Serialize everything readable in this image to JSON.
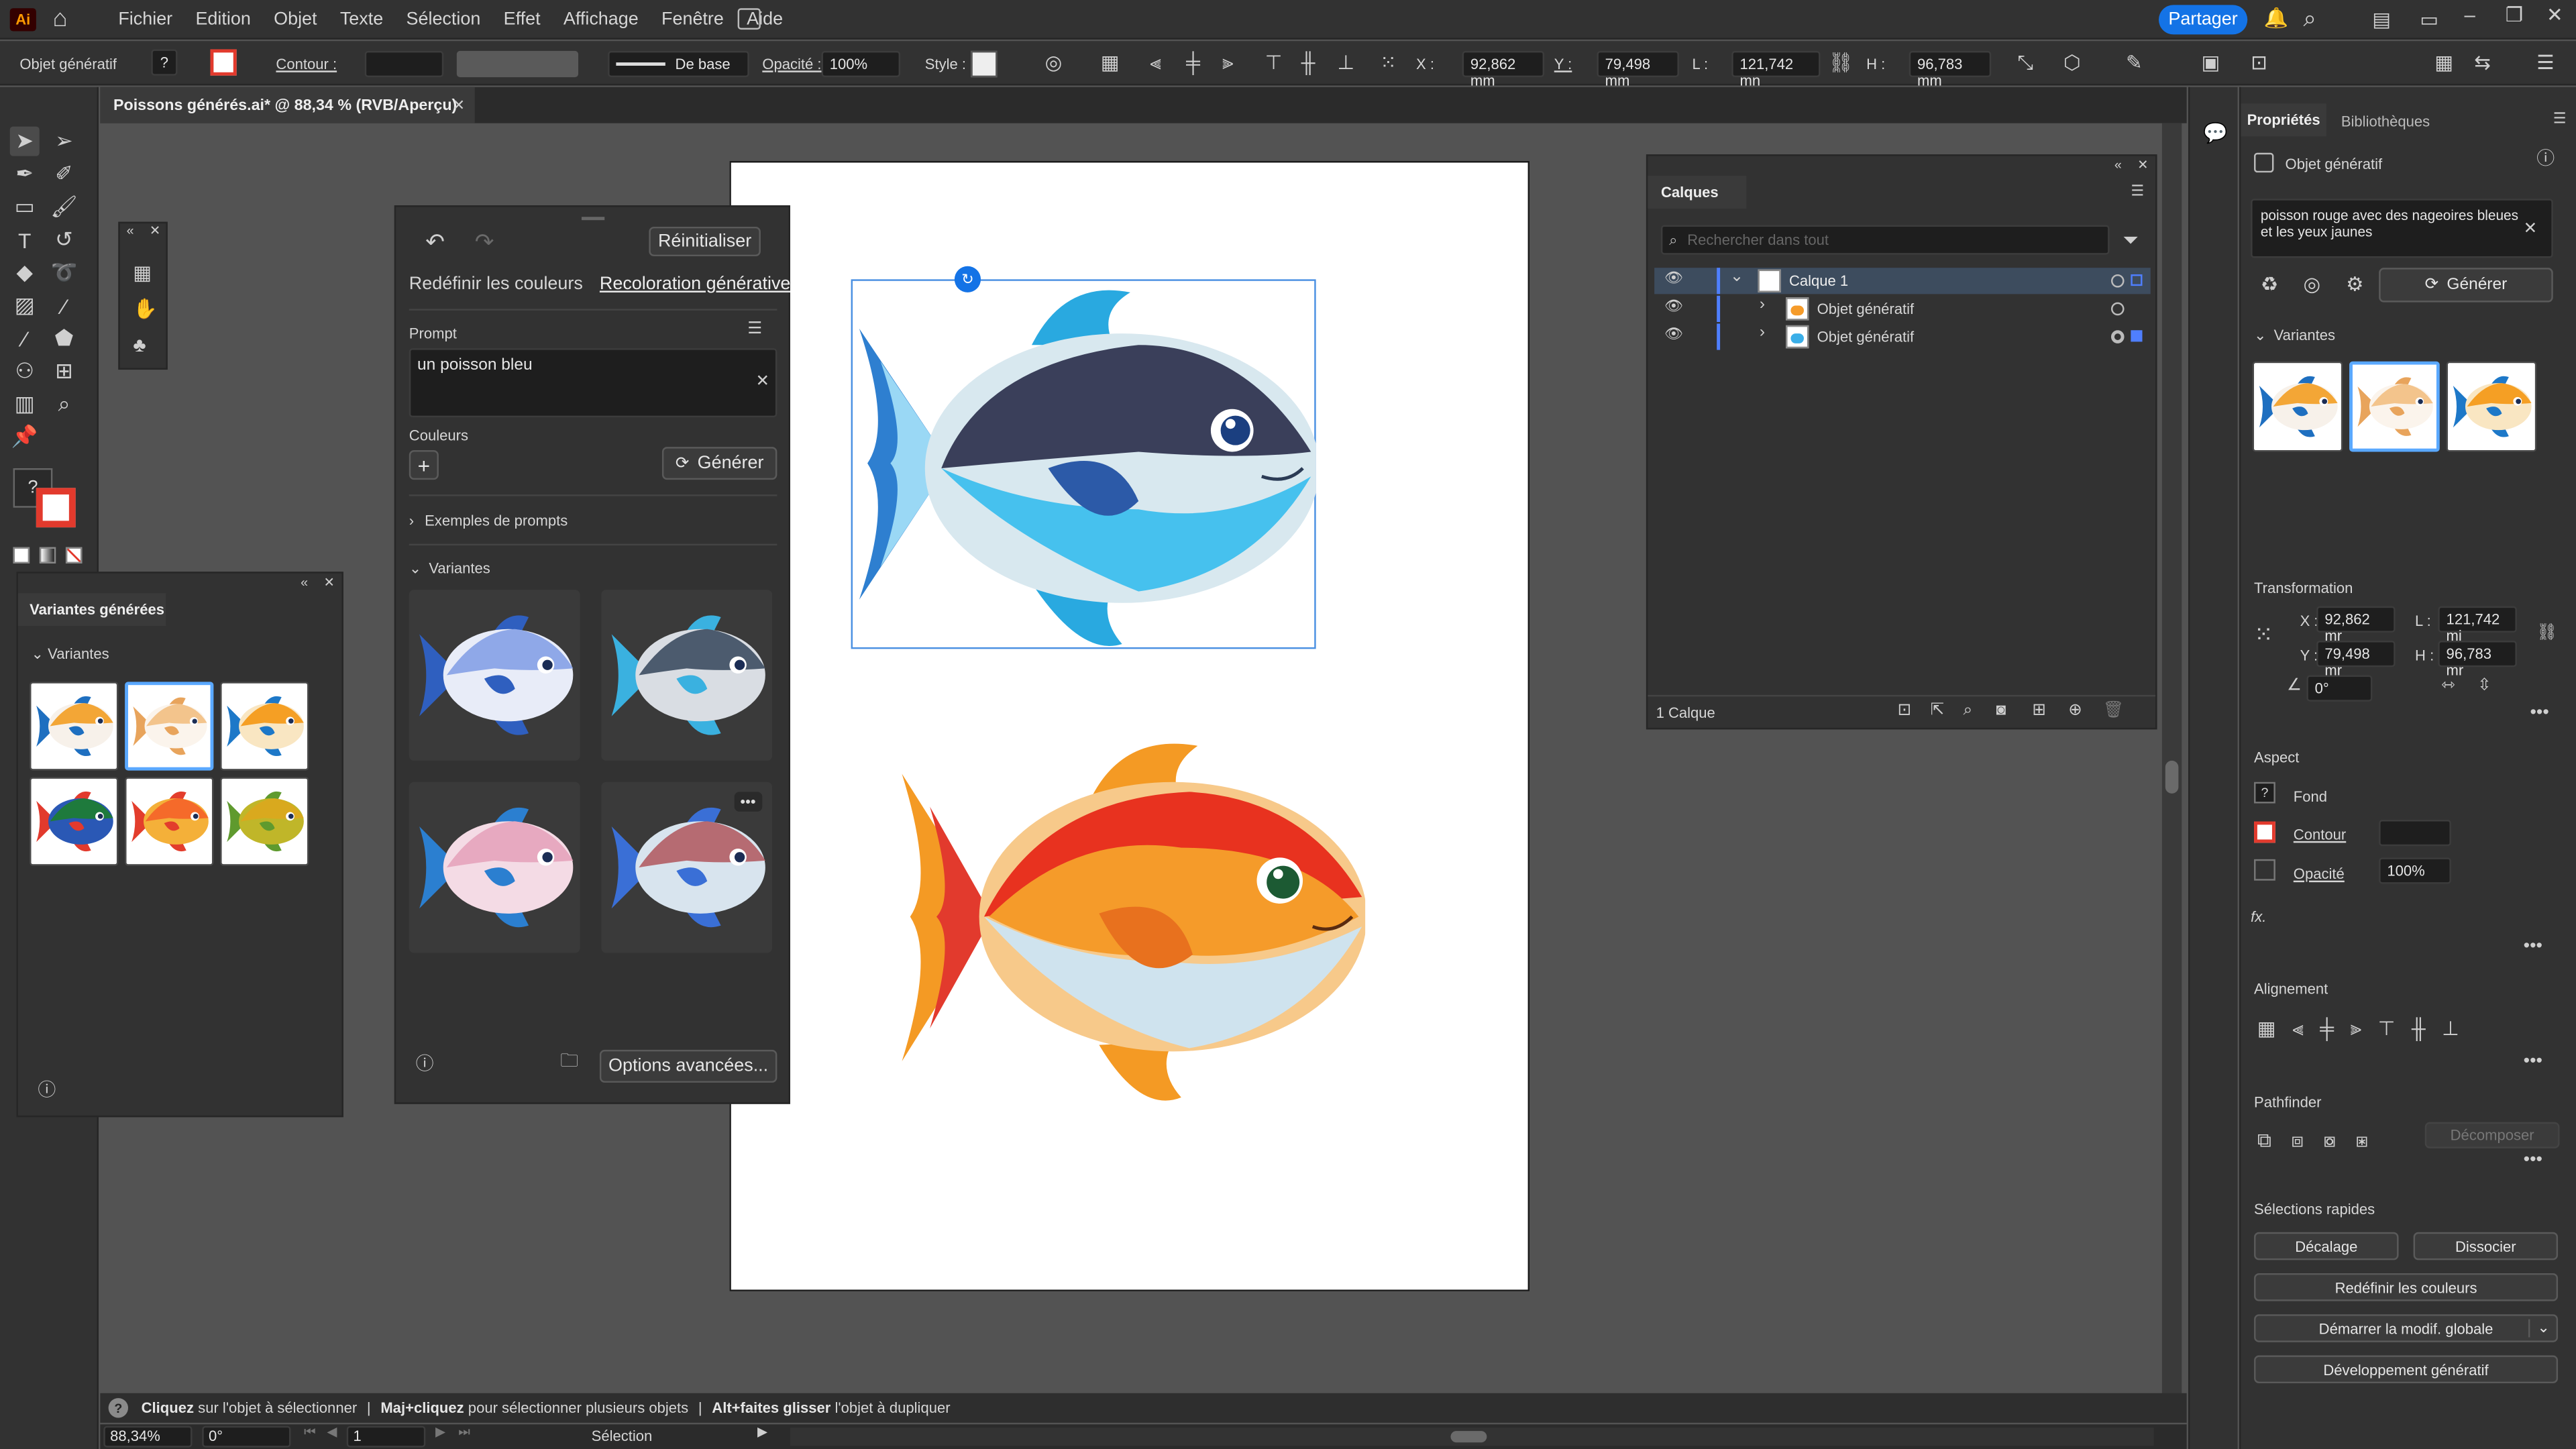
{
  "menubar": {
    "app_logo": "Ai",
    "items": [
      "Fichier",
      "Edition",
      "Objet",
      "Texte",
      "Sélection",
      "Effet",
      "Affichage",
      "Fenêtre",
      "Aide"
    ],
    "share_label": "Partager"
  },
  "controlbar": {
    "object_label": "Objet génératif",
    "contour_label": "Contour :",
    "stroke_style": "De base",
    "opacity_label": "Opacité :",
    "opacity_value": "100%",
    "style_label": "Style :",
    "x_label": "X :",
    "x_value": "92,862 mm",
    "y_label": "Y :",
    "y_value": "79,498 mm",
    "w_label": "L :",
    "w_value": "121,742 mn",
    "h_label": "H :",
    "h_value": "96,783 mm"
  },
  "document_tab": {
    "title": "Poissons générés.ai* @ 88,34 % (RVB/Aperçu)"
  },
  "toolbar_fill_stroke": {
    "question_mark": "?"
  },
  "variants_panel": {
    "title": "Variantes générées",
    "section": "Variantes",
    "colors": [
      [
        "#f3a636",
        "#f7f1ea",
        "#1e6fc0"
      ],
      [
        "#f3c48c",
        "#fbf4ec",
        "#e8a45c"
      ],
      [
        "#f59f24",
        "#f9e6c2",
        "#1d78c8"
      ],
      [
        "#1e7a3c",
        "#2a58b5",
        "#e23a2d"
      ],
      [
        "#f56a2a",
        "#f4b039",
        "#e33d2c"
      ],
      [
        "#d9a91e",
        "#c0b629",
        "#5f9a2e"
      ]
    ]
  },
  "recolor_panel": {
    "tabs": [
      "Redéfinir les couleurs",
      "Recoloration générative"
    ],
    "reset_label": "Réinitialiser",
    "prompt_label": "Prompt",
    "prompt_value": "un poisson bleu",
    "colors_label": "Couleurs",
    "generate_label": "Générer",
    "examples_label": "Exemples de prompts",
    "variants_label": "Variantes",
    "variant_colors": [
      [
        "#8fa8e8",
        "#e8ecf8",
        "#2f5fbf"
      ],
      [
        "#4c5b6e",
        "#d9dde3",
        "#3ab1e0"
      ],
      [
        "#e7a9c0",
        "#f4dbe5",
        "#2b7fd0"
      ],
      [
        "#b66b72",
        "#d8e4ee",
        "#3a6fd6"
      ]
    ],
    "advanced_label": "Options avancées..."
  },
  "layers_panel": {
    "title": "Calques",
    "search_placeholder": "Rechercher dans tout",
    "layers": [
      {
        "name": "Calque 1"
      },
      {
        "name": "Objet génératif"
      },
      {
        "name": "Objet génératif"
      }
    ],
    "footer_count": "1 Calque"
  },
  "properties_panel": {
    "tabs": [
      "Propriétés",
      "Bibliothèques"
    ],
    "object_type": "Objet génératif",
    "prompt_text": "poisson rouge avec des nageoires bleues et les yeux jaunes",
    "generate_label": "Générer",
    "variants_label": "Variantes",
    "variant_colors": [
      [
        "#f3a636",
        "#f7f1ea",
        "#1e6fc0"
      ],
      [
        "#f3c48c",
        "#fbf4ec",
        "#e8a45c"
      ],
      [
        "#f59f24",
        "#f9e6c2",
        "#1d78c8"
      ]
    ],
    "transform_label": "Transformation",
    "x_label": "X :",
    "x_value": "92,862 mr",
    "y_label": "Y :",
    "y_value": "79,498 mr",
    "w_label": "L :",
    "w_value": "121,742 mi",
    "h_label": "H :",
    "h_value": "96,783 mr",
    "angle_value": "0°",
    "aspect_label": "Aspect",
    "fill_label": "Fond",
    "stroke_label": "Contour",
    "opacity_label": "Opacité",
    "opacity_value": "100%",
    "fx_label": "fx.",
    "align_label": "Alignement",
    "pathfinder_label": "Pathfinder",
    "pathfinder_btn": "Décomposer",
    "quick_label": "Sélections rapides",
    "offset_btn": "Décalage",
    "ungroup_btn": "Dissocier",
    "recolor_btn": "Redéfinir les couleurs",
    "global_btn": "Démarrer la modif. globale",
    "gen_expand_btn": "Développement génératif"
  },
  "statusbar": {
    "hint_click": "Cliquez",
    "hint_click_rest": "sur l'objet à sélectionner",
    "hint_shift": "Maj+cliquez",
    "hint_shift_rest": "pour sélectionner plusieurs objets",
    "hint_alt": "Alt+faites glisser",
    "hint_alt_rest": "l'objet à dupliquer",
    "zoom": "88,34%",
    "rotation": "0°",
    "artboard": "1",
    "tool": "Sélection"
  }
}
